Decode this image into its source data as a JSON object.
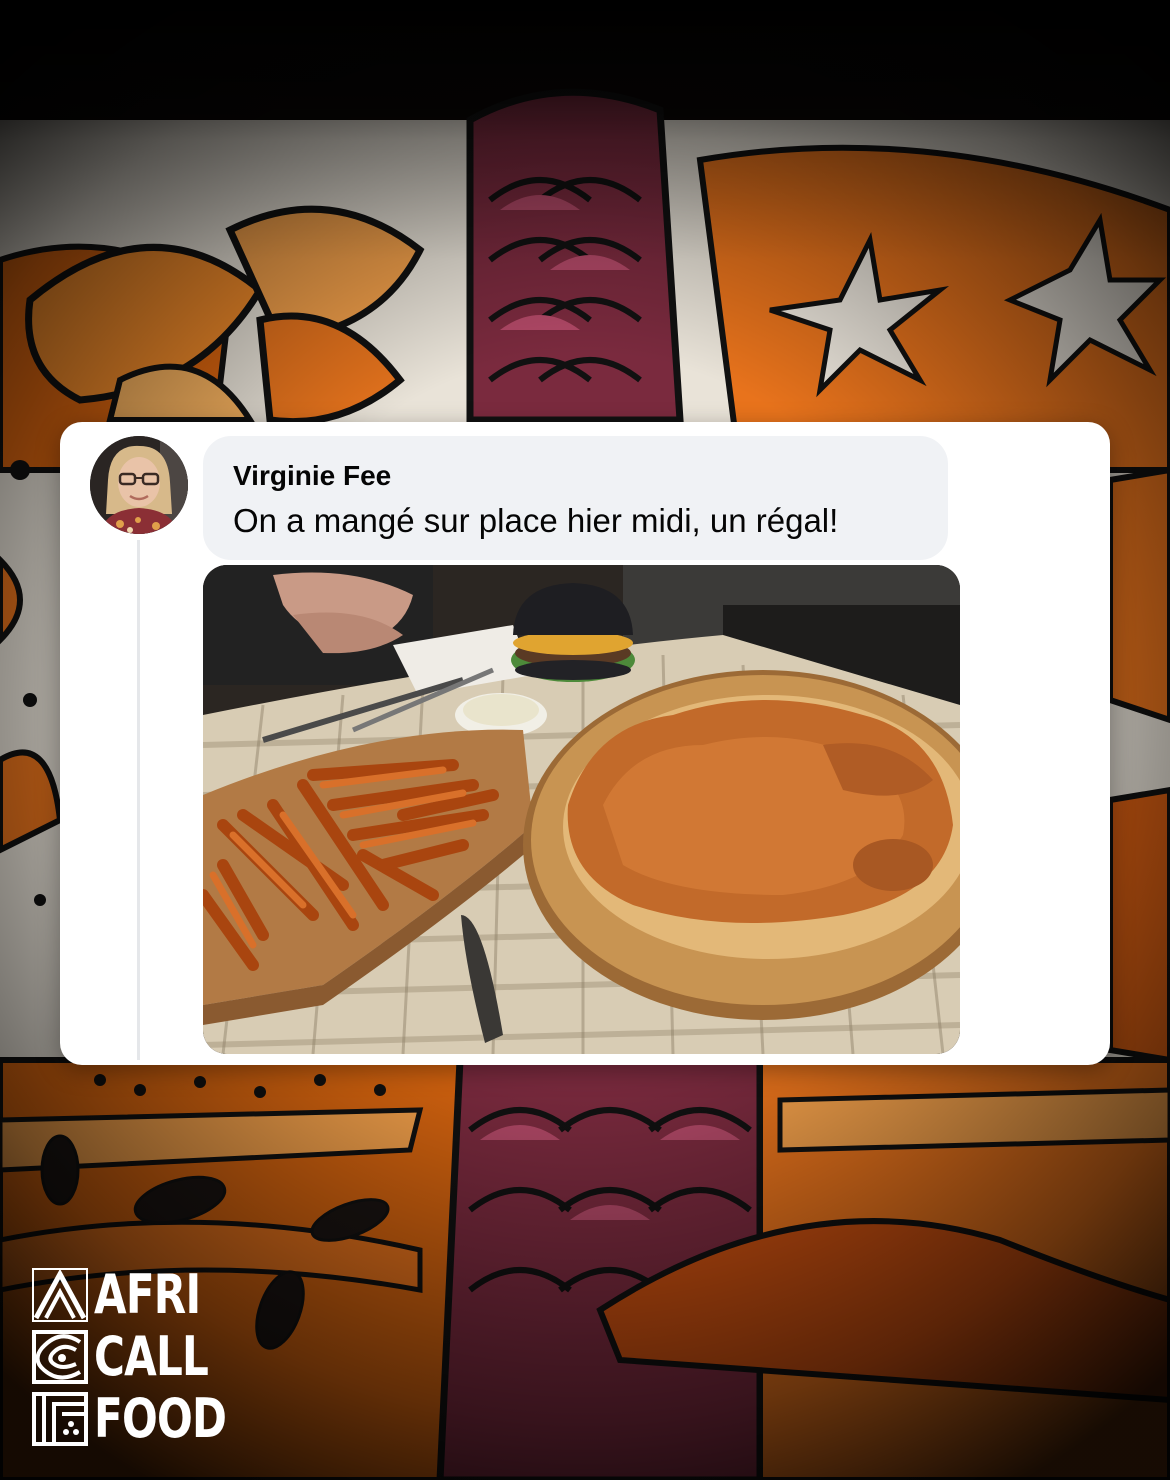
{
  "comment": {
    "author": "Virginie Fee",
    "text": "On a mangé sur place hier midi, un régal!",
    "avatar_icon": "person-avatar-icon"
  },
  "photo": {
    "subject": "food-photo"
  },
  "brand": {
    "line1": "AFRI",
    "line2": "CALL",
    "line3": "FOOD"
  },
  "colors": {
    "orange": "#e8731c",
    "deep_orange": "#c94f10",
    "plum": "#7a2a3e",
    "cream": "#efe9df",
    "ink": "#111111"
  }
}
